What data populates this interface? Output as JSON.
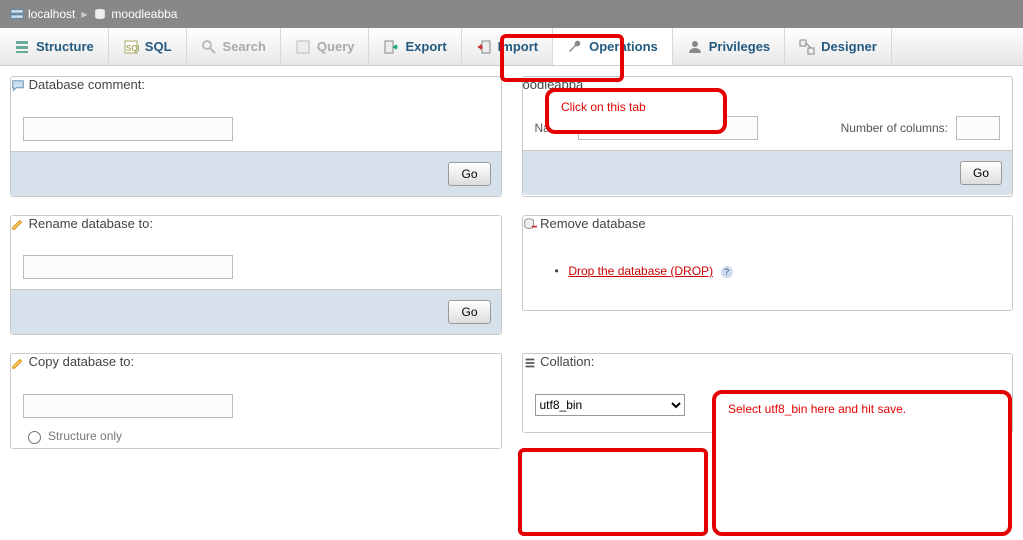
{
  "breadcrumb": {
    "host": "localhost",
    "db": "moodleabba"
  },
  "tabs": {
    "structure": "Structure",
    "sql": "SQL",
    "search": "Search",
    "query": "Query",
    "export": "Export",
    "import": "Import",
    "operations": "Operations",
    "privileges": "Privileges",
    "designer": "Designer"
  },
  "panels": {
    "comment": {
      "legend": "Database comment:",
      "go": "Go",
      "value": ""
    },
    "create": {
      "legend_suffix": "oodleabba",
      "name_label": "Name:",
      "name_value": "",
      "cols_label": "Number of columns:",
      "cols_value": "",
      "go": "Go"
    },
    "rename": {
      "legend": "Rename database to:",
      "go": "Go",
      "value": ""
    },
    "remove": {
      "legend": "Remove database",
      "drop": "Drop the database (DROP)"
    },
    "copy": {
      "legend": "Copy database to:",
      "value": "",
      "opt_structure_only": "Structure only"
    },
    "collation": {
      "legend": "Collation:",
      "value": "utf8_bin"
    }
  },
  "annotations": {
    "tab_hint": "Click on this tab",
    "collation_hint": "Select utf8_bin here and hit save."
  }
}
